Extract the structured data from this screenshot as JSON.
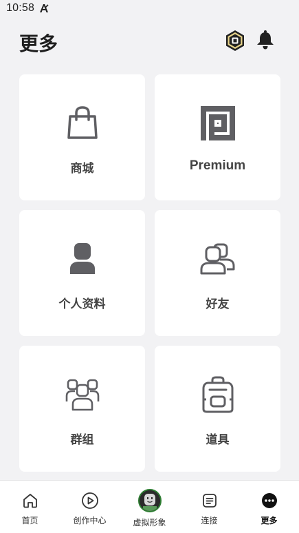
{
  "status_bar": {
    "time": "10:58",
    "indicator_icon": "font-a-icon"
  },
  "header": {
    "title": "更多",
    "robux_icon": "robux-icon",
    "notification_icon": "bell-icon"
  },
  "tiles": [
    {
      "label": "商城",
      "icon": "shopping-bag-icon"
    },
    {
      "label": "Premium",
      "icon": "premium-icon"
    },
    {
      "label": "个人资料",
      "icon": "profile-icon"
    },
    {
      "label": "好友",
      "icon": "friends-icon"
    },
    {
      "label": "群组",
      "icon": "groups-icon"
    },
    {
      "label": "道具",
      "icon": "backpack-icon"
    }
  ],
  "bottom_nav": {
    "items": [
      {
        "label": "首页",
        "icon": "home-icon"
      },
      {
        "label": "创作中心",
        "icon": "play-circle-icon"
      },
      {
        "label": "虚拟形象",
        "icon": "avatar-icon"
      },
      {
        "label": "连接",
        "icon": "chat-icon"
      },
      {
        "label": "更多",
        "icon": "more-dots-icon"
      }
    ],
    "active_label": "更多"
  },
  "colors": {
    "background": "#f2f2f4",
    "tile": "#ffffff",
    "icon": "#5f5f63",
    "text": "#1e1e1e",
    "avatar_ring": "#2e7d32"
  }
}
